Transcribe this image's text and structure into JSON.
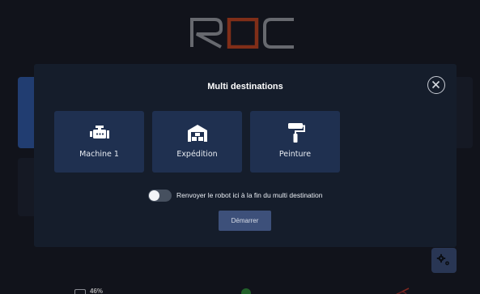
{
  "app": {
    "logo_text": "ROC",
    "battery_text": "46%"
  },
  "modal": {
    "title": "Multi destinations",
    "destinations": [
      {
        "label": "Machine 1",
        "icon": "engine-icon"
      },
      {
        "label": "Expédition",
        "icon": "warehouse-icon"
      },
      {
        "label": "Peinture",
        "icon": "paint-roller-icon"
      }
    ],
    "toggle_label": "Renvoyer le robot ici à la fin du multi destination",
    "toggle_on": false,
    "start_label": "Démarrer"
  },
  "colors": {
    "background": "#161a22",
    "modal": "#151d2b",
    "card": "#1f3050",
    "button": "#3d507a",
    "logo_accent": "#c0421e",
    "logo_gray": "#9a9da3"
  }
}
